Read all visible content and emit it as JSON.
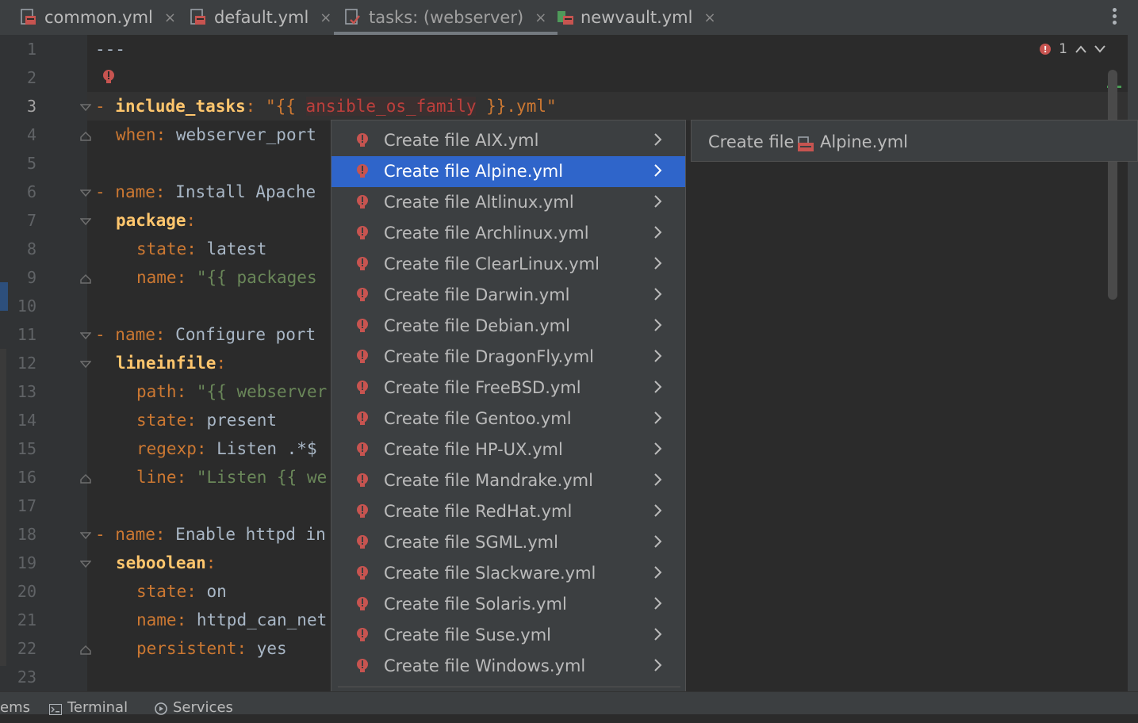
{
  "tabs": [
    {
      "label": "common.yml",
      "close": "×"
    },
    {
      "label": "default.yml",
      "close": "×"
    },
    {
      "label": "tasks: (webserver)",
      "close": "×"
    },
    {
      "label": "newvault.yml",
      "close": "×"
    }
  ],
  "editor": {
    "line_numbers": [
      "1",
      "2",
      "3",
      "4",
      "5",
      "6",
      "7",
      "8",
      "9",
      "10",
      "11",
      "12",
      "13",
      "14",
      "15",
      "16",
      "17",
      "18",
      "19",
      "20",
      "21",
      "22",
      "23"
    ],
    "lines": {
      "l1": "---",
      "l3_dash": "- ",
      "l3_key": "include_tasks",
      "l3_colon": ": ",
      "l3_s1": "\"{{ ",
      "l3_err": "ansible_os_family",
      "l3_s2": " }}.yml\"",
      "l4_key": "when",
      "l4_val": "webserver_port",
      "l6_key": "name",
      "l6_val": "Install Apache",
      "l7_key": "package",
      "l8_key": "state",
      "l8_val": "latest",
      "l9_key": "name",
      "l9_val": "\"{{ packages",
      "l11_key": "name",
      "l11_val": "Configure port",
      "l12_key": "lineinfile",
      "l13_key": "path",
      "l13_val": "\"{{ webserver",
      "l14_key": "state",
      "l14_val": "present",
      "l15_key": "regexp",
      "l15_val": "Listen .*$",
      "l16_key": "line",
      "l16_val": "\"Listen {{ we",
      "l18_key": "name",
      "l18_val": "Enable httpd in",
      "l19_key": "seboolean",
      "l20_key": "state",
      "l20_val": "on",
      "l21_key": "name",
      "l21_val": "httpd_can_net",
      "l22_key": "persistent",
      "l22_val": "yes"
    },
    "error_count": "1"
  },
  "popup": {
    "items": [
      "Create file AIX.yml",
      "Create file Alpine.yml",
      "Create file Altlinux.yml",
      "Create file Archlinux.yml",
      "Create file ClearLinux.yml",
      "Create file Darwin.yml",
      "Create file Debian.yml",
      "Create file DragonFly.yml",
      "Create file FreeBSD.yml",
      "Create file Gentoo.yml",
      "Create file HP-UX.yml",
      "Create file Mandrake.yml",
      "Create file RedHat.yml",
      "Create file SGML.yml",
      "Create file Slackware.yml",
      "Create file Solaris.yml",
      "Create file Suse.yml",
      "Create file Windows.yml"
    ],
    "selected_index": 1,
    "last_item": "Create file"
  },
  "submenu": {
    "prefix": "Create file",
    "filename": "Alpine.yml"
  },
  "statusbar": {
    "problems": "ems",
    "terminal": "Terminal",
    "services": "Services"
  },
  "colors": {
    "selection": "#2f65ca",
    "error_bulb": "#c75450",
    "keyword": "#cc7832",
    "string": "#6a8759"
  }
}
